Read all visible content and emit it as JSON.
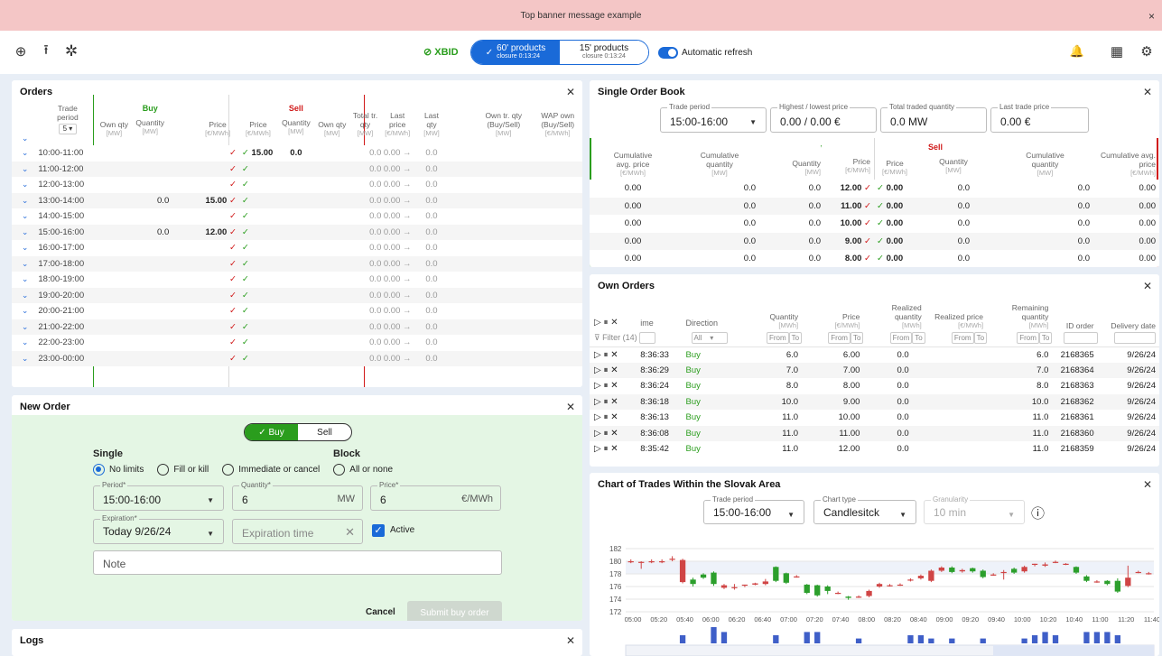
{
  "banner": {
    "text": "Top banner message example",
    "close": "×"
  },
  "toolbar": {
    "add_icon": "⊕",
    "upload_icon": "⭱",
    "network_icon": "✲",
    "status_icon": "⊘",
    "market": "XBID",
    "seg1_title": "60' products",
    "seg1_sub": "closure 0:13:24",
    "seg2_title": "15' products",
    "seg2_sub": "closure 0:13:24",
    "refresh_label": "Automatic refresh",
    "bell_icon": "🔔",
    "grid_icon": "▦",
    "settings_icon": "⚙"
  },
  "orders": {
    "title": "Orders",
    "h_trade": "Trade period",
    "h_select": "5",
    "h_buy": "Buy",
    "h_sell": "Sell",
    "h_own_qty": "Own qty",
    "h_qty": "Quantity",
    "h_price": "Price",
    "h_total": "Total tr. qty",
    "h_last_price": "Last price",
    "h_last_qty": "Last qty",
    "h_own_tr": "Own tr. qty (Buy/Sell)",
    "h_wap": "WAP own (Buy/Sell)",
    "u_mw": "[MW]",
    "u_eur": "[€/MWh]",
    "rows": [
      {
        "p": "10:00-11:00",
        "bq": "",
        "bp": "",
        "sp": "15.00",
        "sq": "0.0",
        "t": "0.0",
        "lp": "0.00",
        "lq": "0.0"
      },
      {
        "p": "11:00-12:00",
        "bq": "",
        "bp": "",
        "sp": "",
        "sq": "",
        "t": "0.0",
        "lp": "0.00",
        "lq": "0.0"
      },
      {
        "p": "12:00-13:00",
        "bq": "",
        "bp": "",
        "sp": "",
        "sq": "",
        "t": "0.0",
        "lp": "0.00",
        "lq": "0.0"
      },
      {
        "p": "13:00-14:00",
        "bq": "0.0",
        "bp": "15.00",
        "sp": "",
        "sq": "",
        "t": "0.0",
        "lp": "0.00",
        "lq": "0.0"
      },
      {
        "p": "14:00-15:00",
        "bq": "",
        "bp": "",
        "sp": "",
        "sq": "",
        "t": "0.0",
        "lp": "0.00",
        "lq": "0.0"
      },
      {
        "p": "15:00-16:00",
        "bq": "0.0",
        "bp": "12.00",
        "sp": "",
        "sq": "",
        "t": "0.0",
        "lp": "0.00",
        "lq": "0.0"
      },
      {
        "p": "16:00-17:00",
        "bq": "",
        "bp": "",
        "sp": "",
        "sq": "",
        "t": "0.0",
        "lp": "0.00",
        "lq": "0.0"
      },
      {
        "p": "17:00-18:00",
        "bq": "",
        "bp": "",
        "sp": "",
        "sq": "",
        "t": "0.0",
        "lp": "0.00",
        "lq": "0.0"
      },
      {
        "p": "18:00-19:00",
        "bq": "",
        "bp": "",
        "sp": "",
        "sq": "",
        "t": "0.0",
        "lp": "0.00",
        "lq": "0.0"
      },
      {
        "p": "19:00-20:00",
        "bq": "",
        "bp": "",
        "sp": "",
        "sq": "",
        "t": "0.0",
        "lp": "0.00",
        "lq": "0.0"
      },
      {
        "p": "20:00-21:00",
        "bq": "",
        "bp": "",
        "sp": "",
        "sq": "",
        "t": "0.0",
        "lp": "0.00",
        "lq": "0.0"
      },
      {
        "p": "21:00-22:00",
        "bq": "",
        "bp": "",
        "sp": "",
        "sq": "",
        "t": "0.0",
        "lp": "0.00",
        "lq": "0.0"
      },
      {
        "p": "22:00-23:00",
        "bq": "",
        "bp": "",
        "sp": "",
        "sq": "",
        "t": "0.0",
        "lp": "0.00",
        "lq": "0.0"
      },
      {
        "p": "23:00-00:00",
        "bq": "",
        "bp": "",
        "sp": "",
        "sq": "",
        "t": "0.0",
        "lp": "0.00",
        "lq": "0.0"
      }
    ]
  },
  "new_order": {
    "title": "New Order",
    "buy": "Buy",
    "sell": "Sell",
    "single": "Single",
    "block": "Block",
    "opt1": "No limits",
    "opt2": "Fill or kill",
    "opt3": "Immediate or cancel",
    "opt4": "All or none",
    "period_label": "Period*",
    "period_value": "15:00-16:00",
    "qty_label": "Quantity*",
    "qty_value": "6",
    "qty_unit": "MW",
    "price_label": "Price*",
    "price_value": "6",
    "price_unit": "€/MWh",
    "exp_label": "Expiration*",
    "exp_value": "Today 9/26/24",
    "exp_time_placeholder": "Expiration time",
    "active_label": "Active",
    "note_placeholder": "Note",
    "cancel": "Cancel",
    "submit": "Submit buy order"
  },
  "logs": {
    "title": "Logs"
  },
  "book": {
    "title": "Single Order Book",
    "f1_label": "Trade period",
    "f1_value": "15:00-16:00",
    "f2_label": "Highest / lowest price",
    "f2_value": "0.00 / 0.00 €",
    "f3_label": "Total traded quantity",
    "f3_value": "0.0 MW",
    "f4_label": "Last trade price",
    "f4_value": "0.00 €",
    "h_cum_avg": "Cumulative avg. price",
    "h_cum_qty": "Cumulative quantity",
    "h_buy": "Buy",
    "h_sell": "Sell",
    "h_qty": "Quantity",
    "h_price": "Price",
    "u_mw": "[MW]",
    "u_eur": "[€/MWh]",
    "rows": [
      {
        "ca": "0.00",
        "cq": "0.0",
        "bq": "0.0",
        "bp": "12.00",
        "sp": "0.00",
        "sq": "0.0",
        "scq": "0.0",
        "sca": "0.00"
      },
      {
        "ca": "0.00",
        "cq": "0.0",
        "bq": "0.0",
        "bp": "11.00",
        "sp": "0.00",
        "sq": "0.0",
        "scq": "0.0",
        "sca": "0.00"
      },
      {
        "ca": "0.00",
        "cq": "0.0",
        "bq": "0.0",
        "bp": "10.00",
        "sp": "0.00",
        "sq": "0.0",
        "scq": "0.0",
        "sca": "0.00"
      },
      {
        "ca": "0.00",
        "cq": "0.0",
        "bq": "0.0",
        "bp": "9.00",
        "sp": "0.00",
        "sq": "0.0",
        "scq": "0.0",
        "sca": "0.00"
      },
      {
        "ca": "0.00",
        "cq": "0.0",
        "bq": "0.0",
        "bp": "8.00",
        "sp": "0.00",
        "sq": "0.0",
        "scq": "0.0",
        "sca": "0.00"
      }
    ]
  },
  "own": {
    "title": "Own Orders",
    "h_time": "ime",
    "h_dir": "Direction",
    "h_qty": "Quantity",
    "h_price": "Price",
    "h_rq": "Realized quantity",
    "h_rp": "Realized price",
    "h_rem": "Remaining quantity",
    "h_id": "ID order",
    "h_del": "Delivery date",
    "u_mw": "[MWh]",
    "u_eur": "[€/MWh]",
    "filter": "Filter (14)",
    "all": "All",
    "from": "From",
    "to": "To",
    "rows": [
      {
        "t": "8:36:33",
        "d": "Buy",
        "q": "6.0",
        "p": "6.00",
        "rq": "0.0",
        "rem": "6.0",
        "id": "2168365",
        "del": "9/26/24"
      },
      {
        "t": "8:36:29",
        "d": "Buy",
        "q": "7.0",
        "p": "7.00",
        "rq": "0.0",
        "rem": "7.0",
        "id": "2168364",
        "del": "9/26/24"
      },
      {
        "t": "8:36:24",
        "d": "Buy",
        "q": "8.0",
        "p": "8.00",
        "rq": "0.0",
        "rem": "8.0",
        "id": "2168363",
        "del": "9/26/24"
      },
      {
        "t": "8:36:18",
        "d": "Buy",
        "q": "10.0",
        "p": "9.00",
        "rq": "0.0",
        "rem": "10.0",
        "id": "2168362",
        "del": "9/26/24"
      },
      {
        "t": "8:36:13",
        "d": "Buy",
        "q": "11.0",
        "p": "10.00",
        "rq": "0.0",
        "rem": "11.0",
        "id": "2168361",
        "del": "9/26/24"
      },
      {
        "t": "8:36:08",
        "d": "Buy",
        "q": "11.0",
        "p": "11.00",
        "rq": "0.0",
        "rem": "11.0",
        "id": "2168360",
        "del": "9/26/24"
      },
      {
        "t": "8:35:42",
        "d": "Buy",
        "q": "11.0",
        "p": "12.00",
        "rq": "0.0",
        "rem": "11.0",
        "id": "2168359",
        "del": "9/26/24"
      }
    ]
  },
  "chart": {
    "title": "Chart of Trades Within the Slovak Area",
    "f1_label": "Trade period",
    "f1_value": "15:00-16:00",
    "f2_label": "Chart type",
    "f2_value": "Candlesitck",
    "f3_label": "Granularity",
    "f3_value": "10 min",
    "info_icon": "ⓘ"
  },
  "chart_data": {
    "type": "candlestick",
    "ylim": [
      172,
      182
    ],
    "yticks": [
      "182",
      "180",
      "178",
      "176",
      "174",
      "172"
    ],
    "xticks": [
      "05:00",
      "05:20",
      "05:40",
      "06:00",
      "06:20",
      "06:40",
      "07:00",
      "07:20",
      "07:40",
      "08:00",
      "08:20",
      "08:40",
      "09:00",
      "09:20",
      "09:40",
      "10:00",
      "10:20",
      "10:40",
      "11:00",
      "11:20",
      "11:40"
    ],
    "candles": [
      {
        "o": 180,
        "c": 180,
        "h": 180.3,
        "l": 179.7,
        "v": 0
      },
      {
        "o": 179.9,
        "c": 179.9,
        "h": 180,
        "l": 178.8,
        "v": 0
      },
      {
        "o": 180,
        "c": 180,
        "h": 180.3,
        "l": 179.7,
        "v": 0
      },
      {
        "o": 180,
        "c": 180,
        "h": 180.3,
        "l": 179.7,
        "v": 0
      },
      {
        "o": 180.4,
        "c": 180.4,
        "h": 180.8,
        "l": 180,
        "v": 0
      },
      {
        "o": 176.7,
        "c": 180.2,
        "h": 180.4,
        "l": 176.5,
        "v": 0.5
      },
      {
        "o": 177.1,
        "c": 176.4,
        "h": 177.4,
        "l": 176,
        "v": 0
      },
      {
        "o": 177.9,
        "c": 177.4,
        "h": 178.1,
        "l": 177.2,
        "v": 0
      },
      {
        "o": 178.2,
        "c": 176.4,
        "h": 178.4,
        "l": 176.1,
        "v": 1
      },
      {
        "o": 175.8,
        "c": 176.2,
        "h": 176.4,
        "l": 175.6,
        "v": 0.7
      },
      {
        "o": 175.9,
        "c": 175.9,
        "h": 176.4,
        "l": 175.5,
        "v": 0
      },
      {
        "o": 176.3,
        "c": 176.3,
        "h": 176.3,
        "l": 175.9,
        "v": 0
      },
      {
        "o": 176.3,
        "c": 176.5,
        "h": 176.6,
        "l": 176.2,
        "v": 0
      },
      {
        "o": 176.4,
        "c": 176.8,
        "h": 177.2,
        "l": 176.2,
        "v": 0
      },
      {
        "o": 179.1,
        "c": 176.9,
        "h": 179.2,
        "l": 176.7,
        "v": 0.5
      },
      {
        "o": 178.1,
        "c": 176.6,
        "h": 178.2,
        "l": 176.4,
        "v": 0
      },
      {
        "o": 177.6,
        "c": 177.6,
        "h": 177.8,
        "l": 177.4,
        "v": 0
      },
      {
        "o": 176.3,
        "c": 175,
        "h": 176.4,
        "l": 174.8,
        "v": 0.7
      },
      {
        "o": 176.2,
        "c": 174.6,
        "h": 176.3,
        "l": 174.4,
        "v": 0.7
      },
      {
        "o": 176,
        "c": 175.3,
        "h": 176.2,
        "l": 174.8,
        "v": 0
      },
      {
        "o": 175,
        "c": 175,
        "h": 175.2,
        "l": 174.8,
        "v": 0
      },
      {
        "o": 174.4,
        "c": 174.2,
        "h": 174.5,
        "l": 173.9,
        "v": 0
      },
      {
        "o": 174.4,
        "c": 174.4,
        "h": 174.6,
        "l": 174.2,
        "v": 0.3
      },
      {
        "o": 174.5,
        "c": 175.3,
        "h": 175.5,
        "l": 174.3,
        "v": 0
      },
      {
        "o": 176,
        "c": 176.4,
        "h": 176.6,
        "l": 175.8,
        "v": 0
      },
      {
        "o": 176.2,
        "c": 176.2,
        "h": 176.4,
        "l": 176,
        "v": 0
      },
      {
        "o": 176.3,
        "c": 176.3,
        "h": 176.5,
        "l": 176.1,
        "v": 0
      },
      {
        "o": 177.1,
        "c": 177.1,
        "h": 177.3,
        "l": 176.8,
        "v": 0.5
      },
      {
        "o": 177.3,
        "c": 177.7,
        "h": 177.9,
        "l": 177.1,
        "v": 0.5
      },
      {
        "o": 176.9,
        "c": 178.5,
        "h": 178.7,
        "l": 176.7,
        "v": 0.3
      },
      {
        "o": 178.5,
        "c": 179,
        "h": 179.2,
        "l": 178.3,
        "v": 0
      },
      {
        "o": 179,
        "c": 178.3,
        "h": 179.2,
        "l": 178.1,
        "v": 0.3
      },
      {
        "o": 178.4,
        "c": 178.6,
        "h": 178.8,
        "l": 178.2,
        "v": 0
      },
      {
        "o": 178.9,
        "c": 178.4,
        "h": 179,
        "l": 178.2,
        "v": 0
      },
      {
        "o": 178.5,
        "c": 177.5,
        "h": 178.7,
        "l": 177.3,
        "v": 0.3
      },
      {
        "o": 177.9,
        "c": 177.9,
        "h": 178.1,
        "l": 177.7,
        "v": 0
      },
      {
        "o": 178.3,
        "c": 178.3,
        "h": 178.6,
        "l": 177.1,
        "v": 0
      },
      {
        "o": 178.8,
        "c": 178.2,
        "h": 179,
        "l": 178,
        "v": 0
      },
      {
        "o": 178.4,
        "c": 179.1,
        "h": 179.3,
        "l": 178.2,
        "v": 0.3
      },
      {
        "o": 179.6,
        "c": 179.6,
        "h": 179.6,
        "l": 179.2,
        "v": 0.5
      },
      {
        "o": 179.3,
        "c": 179.5,
        "h": 179.8,
        "l": 179.1,
        "v": 0.7
      },
      {
        "o": 179.9,
        "c": 179.9,
        "h": 180.1,
        "l": 179.7,
        "v": 0.5
      },
      {
        "o": 179.6,
        "c": 179.6,
        "h": 179.7,
        "l": 179.4,
        "v": 0
      },
      {
        "o": 179.1,
        "c": 178.2,
        "h": 179.2,
        "l": 178,
        "v": 0
      },
      {
        "o": 177.6,
        "c": 176.9,
        "h": 177.8,
        "l": 176.7,
        "v": 0.7
      },
      {
        "o": 176.8,
        "c": 176.8,
        "h": 177,
        "l": 176.6,
        "v": 0.7
      },
      {
        "o": 176.9,
        "c": 176.4,
        "h": 177,
        "l": 176.2,
        "v": 0.7
      },
      {
        "o": 176.9,
        "c": 175.2,
        "h": 177.3,
        "l": 175,
        "v": 0.5
      },
      {
        "o": 176.1,
        "c": 177.4,
        "h": 179.3,
        "l": 175.9,
        "v": 0
      },
      {
        "o": 178.3,
        "c": 178.3,
        "h": 178.5,
        "l": 178.1,
        "v": 0
      },
      {
        "o": 178.1,
        "c": 178.1,
        "h": 178.3,
        "l": 177.9,
        "v": 0
      }
    ]
  }
}
